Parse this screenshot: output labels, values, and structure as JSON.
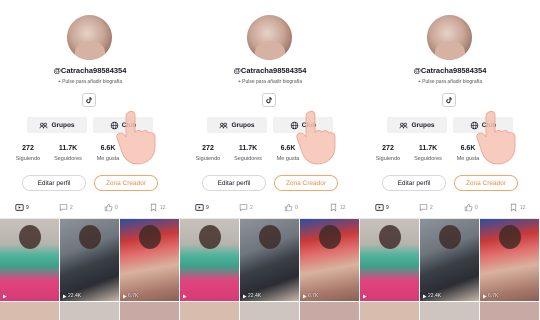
{
  "panels": [
    {
      "username": "@Catracha98584354",
      "bio": "+ Pulse para añadir biografía",
      "chips": {
        "grupos": "Grupos",
        "club": "Club"
      },
      "stats": [
        {
          "value": "272",
          "label": "Siguiendo"
        },
        {
          "value": "11.7K",
          "label": "Seguidores"
        },
        {
          "value": "6.6K",
          "label": "Me gusta"
        }
      ],
      "buttons": {
        "edit": "Editar perfil",
        "creator": "Zona Creador"
      },
      "tabs": {
        "videos": "9",
        "messages": "2",
        "likes": "0",
        "saved": "12"
      },
      "thumbs": [
        "",
        "22.4K",
        "6.7K"
      ]
    },
    {
      "username": "@Catracha98584354",
      "bio": "+ Pulse para añadir biografía",
      "chips": {
        "grupos": "Grupos",
        "club": "Club"
      },
      "stats": [
        {
          "value": "272",
          "label": "Siguiendo"
        },
        {
          "value": "11.7K",
          "label": "Seguidores"
        },
        {
          "value": "6.6K",
          "label": "Me gusta"
        }
      ],
      "buttons": {
        "edit": "Editar perfil",
        "creator": "Zona Creador"
      },
      "tabs": {
        "videos": "9",
        "messages": "2",
        "likes": "0",
        "saved": "12"
      },
      "thumbs": [
        "",
        "22.4K",
        "6.7K"
      ]
    },
    {
      "username": "@Catracha98584354",
      "bio": "+ Pulse para añadir biografía",
      "chips": {
        "grupos": "Grupos",
        "club": "Club"
      },
      "stats": [
        {
          "value": "272",
          "label": "Siguiendo"
        },
        {
          "value": "11.7K",
          "label": "Seguidores"
        },
        {
          "value": "6.6K",
          "label": "Me gusta"
        }
      ],
      "buttons": {
        "edit": "Editar perfil",
        "creator": "Zona Creador"
      },
      "tabs": {
        "videos": "9",
        "messages": "2",
        "likes": "0",
        "saved": "12"
      },
      "thumbs": [
        "",
        "22.4K",
        "6.7K"
      ]
    }
  ],
  "colors": {
    "accent": "#ef8a3b",
    "text": "#161823",
    "chip_bg": "#f1f1f2"
  },
  "icons": [
    "tiktok-icon",
    "groups-icon",
    "globe-icon",
    "video-grid-icon",
    "message-icon",
    "like-icon",
    "bookmark-icon",
    "play-icon",
    "pointing-hand-icon"
  ]
}
